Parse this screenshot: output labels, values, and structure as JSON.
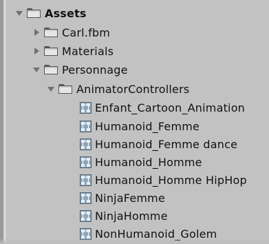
{
  "tree": {
    "root": {
      "label": "Assets",
      "icon": "folder-icon",
      "expanded": true
    },
    "children": [
      {
        "label": "Carl.fbm",
        "icon": "folder-icon",
        "expanded": false
      },
      {
        "label": "Materials",
        "icon": "folder-icon",
        "expanded": false
      },
      {
        "label": "Personnage",
        "icon": "folder-icon",
        "expanded": true
      }
    ],
    "subfolder": {
      "label": "AnimatorControllers",
      "icon": "folder-icon",
      "expanded": true
    },
    "controllers": [
      {
        "label": "Enfant_Cartoon_Animation",
        "icon": "animator-controller-icon"
      },
      {
        "label": "Humanoid_Femme",
        "icon": "animator-controller-icon"
      },
      {
        "label": "Humanoid_Femme dance",
        "icon": "animator-controller-icon"
      },
      {
        "label": "Humanoid_Homme",
        "icon": "animator-controller-icon"
      },
      {
        "label": "Humanoid_Homme HipHop",
        "icon": "animator-controller-icon"
      },
      {
        "label": "NinjaFemme",
        "icon": "animator-controller-icon"
      },
      {
        "label": "NinjaHomme",
        "icon": "animator-controller-icon"
      },
      {
        "label": "NonHumanoid_Golem",
        "icon": "animator-controller-icon"
      }
    ]
  },
  "colors": {
    "panel_bg": "#c2c2c2",
    "text": "#111111",
    "arrow": "#707070",
    "folder": "#e6e6e6"
  }
}
